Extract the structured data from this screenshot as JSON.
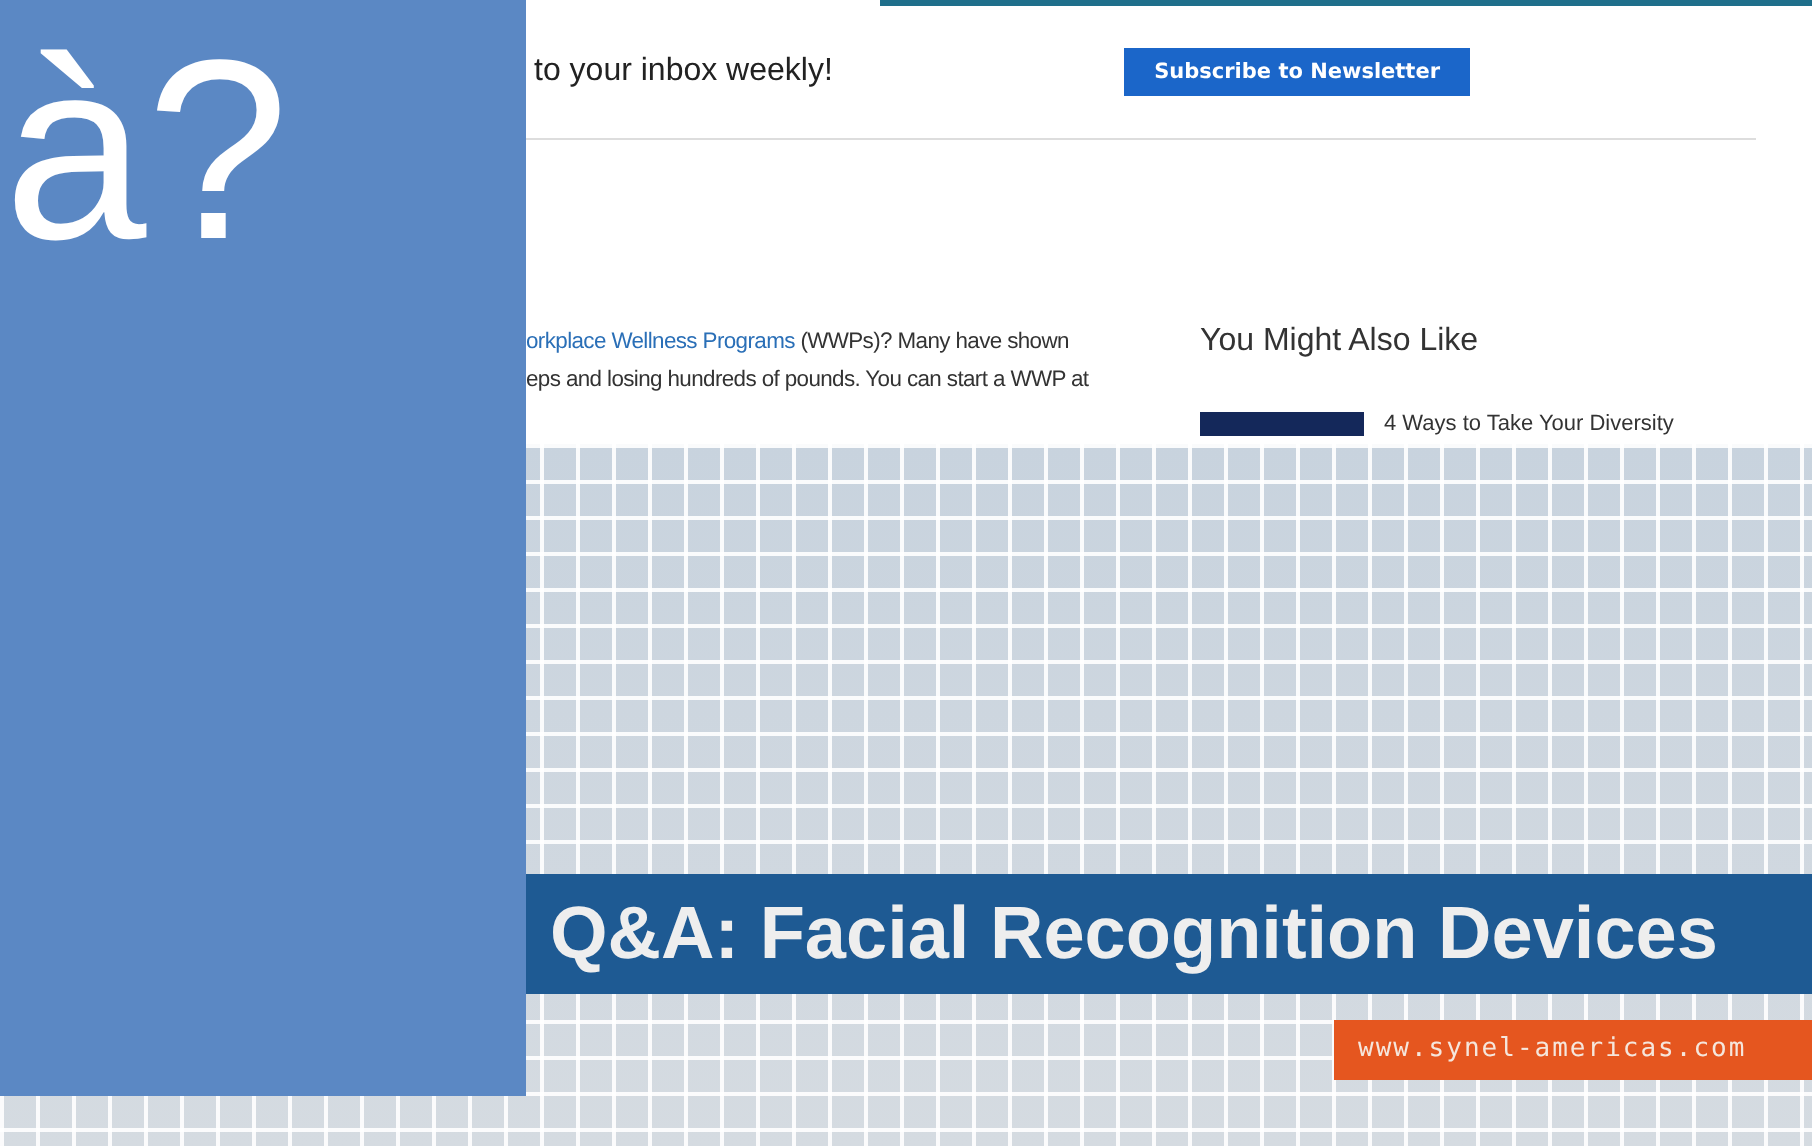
{
  "newsletter": {
    "prompt": "to your inbox weekly!",
    "button": "Subscribe to Newsletter"
  },
  "article": {
    "link": "orkplace Wellness Programs",
    "line1_rest": " (WWPs)? Many have shown",
    "line2": "eps and losing hundreds of pounds. You can start a WWP at"
  },
  "related": {
    "heading": "You Might Also Like",
    "items": [
      {
        "title": "4 Ways to Take Your Diversity"
      }
    ]
  },
  "banner": {
    "title": "Q&A: Facial Recognition Devices",
    "url": "www.synel-americas.com"
  },
  "overlay": {
    "text": "à?"
  }
}
